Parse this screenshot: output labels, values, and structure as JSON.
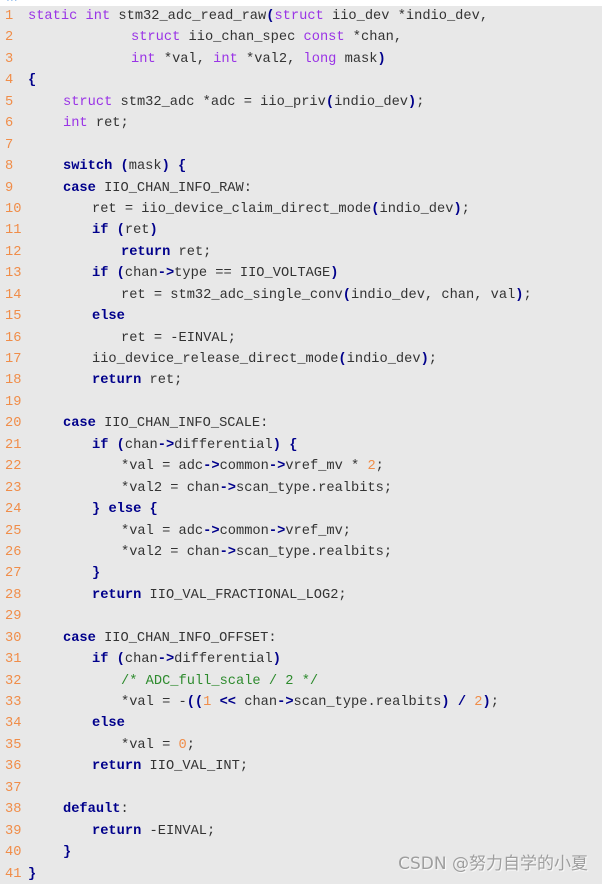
{
  "page": {
    "cutoff_text": "...",
    "watermark": "CSDN @努力自学的小夏",
    "colors": {
      "background": "#e8e8e8",
      "line_number": "#f08d49",
      "keyword": "#00008b",
      "type": "#9a34e6",
      "number": "#f08d49",
      "comment": "#2e8b2e",
      "text": "#333333"
    }
  },
  "code": {
    "language": "c",
    "lines": [
      {
        "n": "1",
        "indent": "i0",
        "tokens": [
          [
            "type",
            "static"
          ],
          [
            "text",
            " "
          ],
          [
            "type",
            "int"
          ],
          [
            "text",
            " stm32_adc_read_raw"
          ],
          [
            "op",
            "("
          ],
          [
            "type",
            "struct"
          ],
          [
            "text",
            " iio_dev *indio_dev,"
          ]
        ]
      },
      {
        "n": "2",
        "indent": "icont",
        "tokens": [
          [
            "type",
            "struct"
          ],
          [
            "text",
            " iio_chan_spec "
          ],
          [
            "type",
            "const"
          ],
          [
            "text",
            " *chan,"
          ]
        ]
      },
      {
        "n": "3",
        "indent": "icont",
        "tokens": [
          [
            "type",
            "int"
          ],
          [
            "text",
            " *val, "
          ],
          [
            "type",
            "int"
          ],
          [
            "text",
            " *val2, "
          ],
          [
            "type",
            "long"
          ],
          [
            "text",
            " mask"
          ],
          [
            "op",
            ")"
          ]
        ]
      },
      {
        "n": "4",
        "indent": "i0",
        "tokens": [
          [
            "op",
            "{"
          ]
        ]
      },
      {
        "n": "5",
        "indent": "i1",
        "tokens": [
          [
            "type",
            "struct"
          ],
          [
            "text",
            " stm32_adc *adc = iio_priv"
          ],
          [
            "op",
            "("
          ],
          [
            "text",
            "indio_dev"
          ],
          [
            "op",
            ")"
          ],
          [
            "text",
            ";"
          ]
        ]
      },
      {
        "n": "6",
        "indent": "i1",
        "tokens": [
          [
            "type",
            "int"
          ],
          [
            "text",
            " ret;"
          ]
        ]
      },
      {
        "n": "7",
        "indent": "i0",
        "tokens": []
      },
      {
        "n": "8",
        "indent": "i1",
        "tokens": [
          [
            "kw",
            "switch"
          ],
          [
            "text",
            " "
          ],
          [
            "op",
            "("
          ],
          [
            "text",
            "mask"
          ],
          [
            "op",
            ")"
          ],
          [
            "text",
            " "
          ],
          [
            "op",
            "{"
          ]
        ]
      },
      {
        "n": "9",
        "indent": "i1",
        "tokens": [
          [
            "kw",
            "case"
          ],
          [
            "text",
            " IIO_CHAN_INFO_RAW:"
          ]
        ]
      },
      {
        "n": "10",
        "indent": "i2",
        "tokens": [
          [
            "text",
            "ret = iio_device_claim_direct_mode"
          ],
          [
            "op",
            "("
          ],
          [
            "text",
            "indio_dev"
          ],
          [
            "op",
            ")"
          ],
          [
            "text",
            ";"
          ]
        ]
      },
      {
        "n": "11",
        "indent": "i2",
        "tokens": [
          [
            "kw",
            "if"
          ],
          [
            "text",
            " "
          ],
          [
            "op",
            "("
          ],
          [
            "text",
            "ret"
          ],
          [
            "op",
            ")"
          ]
        ]
      },
      {
        "n": "12",
        "indent": "i3",
        "tokens": [
          [
            "kw",
            "return"
          ],
          [
            "text",
            " ret;"
          ]
        ]
      },
      {
        "n": "13",
        "indent": "i2",
        "tokens": [
          [
            "kw",
            "if"
          ],
          [
            "text",
            " "
          ],
          [
            "op",
            "("
          ],
          [
            "text",
            "chan"
          ],
          [
            "op",
            "->"
          ],
          [
            "text",
            "type == IIO_VOLTAGE"
          ],
          [
            "op",
            ")"
          ]
        ]
      },
      {
        "n": "14",
        "indent": "i3",
        "tokens": [
          [
            "text",
            "ret = stm32_adc_single_conv"
          ],
          [
            "op",
            "("
          ],
          [
            "text",
            "indio_dev, chan, val"
          ],
          [
            "op",
            ")"
          ],
          [
            "text",
            ";"
          ]
        ]
      },
      {
        "n": "15",
        "indent": "i2",
        "tokens": [
          [
            "kw",
            "else"
          ]
        ]
      },
      {
        "n": "16",
        "indent": "i3",
        "tokens": [
          [
            "text",
            "ret = -EINVAL;"
          ]
        ]
      },
      {
        "n": "17",
        "indent": "i2",
        "tokens": [
          [
            "text",
            "iio_device_release_direct_mode"
          ],
          [
            "op",
            "("
          ],
          [
            "text",
            "indio_dev"
          ],
          [
            "op",
            ")"
          ],
          [
            "text",
            ";"
          ]
        ]
      },
      {
        "n": "18",
        "indent": "i2",
        "tokens": [
          [
            "kw",
            "return"
          ],
          [
            "text",
            " ret;"
          ]
        ]
      },
      {
        "n": "19",
        "indent": "i0",
        "tokens": []
      },
      {
        "n": "20",
        "indent": "i1",
        "tokens": [
          [
            "kw",
            "case"
          ],
          [
            "text",
            " IIO_CHAN_INFO_SCALE:"
          ]
        ]
      },
      {
        "n": "21",
        "indent": "i2",
        "tokens": [
          [
            "kw",
            "if"
          ],
          [
            "text",
            " "
          ],
          [
            "op",
            "("
          ],
          [
            "text",
            "chan"
          ],
          [
            "op",
            "->"
          ],
          [
            "text",
            "differential"
          ],
          [
            "op",
            ")"
          ],
          [
            "text",
            " "
          ],
          [
            "op",
            "{"
          ]
        ]
      },
      {
        "n": "22",
        "indent": "i3",
        "tokens": [
          [
            "text",
            "*val = adc"
          ],
          [
            "op",
            "->"
          ],
          [
            "text",
            "common"
          ],
          [
            "op",
            "->"
          ],
          [
            "text",
            "vref_mv * "
          ],
          [
            "num",
            "2"
          ],
          [
            "text",
            ";"
          ]
        ]
      },
      {
        "n": "23",
        "indent": "i3",
        "tokens": [
          [
            "text",
            "*val2 = chan"
          ],
          [
            "op",
            "->"
          ],
          [
            "text",
            "scan_type.realbits;"
          ]
        ]
      },
      {
        "n": "24",
        "indent": "i2",
        "tokens": [
          [
            "op",
            "}"
          ],
          [
            "text",
            " "
          ],
          [
            "kw",
            "else"
          ],
          [
            "text",
            " "
          ],
          [
            "op",
            "{"
          ]
        ]
      },
      {
        "n": "25",
        "indent": "i3",
        "tokens": [
          [
            "text",
            "*val = adc"
          ],
          [
            "op",
            "->"
          ],
          [
            "text",
            "common"
          ],
          [
            "op",
            "->"
          ],
          [
            "text",
            "vref_mv;"
          ]
        ]
      },
      {
        "n": "26",
        "indent": "i3",
        "tokens": [
          [
            "text",
            "*val2 = chan"
          ],
          [
            "op",
            "->"
          ],
          [
            "text",
            "scan_type.realbits;"
          ]
        ]
      },
      {
        "n": "27",
        "indent": "i2",
        "tokens": [
          [
            "op",
            "}"
          ]
        ]
      },
      {
        "n": "28",
        "indent": "i2",
        "tokens": [
          [
            "kw",
            "return"
          ],
          [
            "text",
            " IIO_VAL_FRACTIONAL_LOG2;"
          ]
        ]
      },
      {
        "n": "29",
        "indent": "i0",
        "tokens": []
      },
      {
        "n": "30",
        "indent": "i1",
        "tokens": [
          [
            "kw",
            "case"
          ],
          [
            "text",
            " IIO_CHAN_INFO_OFFSET:"
          ]
        ]
      },
      {
        "n": "31",
        "indent": "i2",
        "tokens": [
          [
            "kw",
            "if"
          ],
          [
            "text",
            " "
          ],
          [
            "op",
            "("
          ],
          [
            "text",
            "chan"
          ],
          [
            "op",
            "->"
          ],
          [
            "text",
            "differential"
          ],
          [
            "op",
            ")"
          ]
        ]
      },
      {
        "n": "32",
        "indent": "i3",
        "tokens": [
          [
            "cmt",
            "/* ADC_full_scale / 2 */"
          ]
        ]
      },
      {
        "n": "33",
        "indent": "i3",
        "tokens": [
          [
            "text",
            "*val = -"
          ],
          [
            "op",
            "(("
          ],
          [
            "num",
            "1"
          ],
          [
            "text",
            " "
          ],
          [
            "op",
            "<<"
          ],
          [
            "text",
            " chan"
          ],
          [
            "op",
            "->"
          ],
          [
            "text",
            "scan_type.realbits"
          ],
          [
            "op",
            ")"
          ],
          [
            "text",
            " "
          ],
          [
            "op",
            "/"
          ],
          [
            "text",
            " "
          ],
          [
            "num",
            "2"
          ],
          [
            "op",
            ")"
          ],
          [
            "text",
            ";"
          ]
        ]
      },
      {
        "n": "34",
        "indent": "i2",
        "tokens": [
          [
            "kw",
            "else"
          ]
        ]
      },
      {
        "n": "35",
        "indent": "i3",
        "tokens": [
          [
            "text",
            "*val = "
          ],
          [
            "num",
            "0"
          ],
          [
            "text",
            ";"
          ]
        ]
      },
      {
        "n": "36",
        "indent": "i2",
        "tokens": [
          [
            "kw",
            "return"
          ],
          [
            "text",
            " IIO_VAL_INT;"
          ]
        ]
      },
      {
        "n": "37",
        "indent": "i0",
        "tokens": []
      },
      {
        "n": "38",
        "indent": "i1",
        "tokens": [
          [
            "kw",
            "default"
          ],
          [
            "text",
            ":"
          ]
        ]
      },
      {
        "n": "39",
        "indent": "i2",
        "tokens": [
          [
            "kw",
            "return"
          ],
          [
            "text",
            " -EINVAL;"
          ]
        ]
      },
      {
        "n": "40",
        "indent": "i1",
        "tokens": [
          [
            "op",
            "}"
          ]
        ]
      },
      {
        "n": "41",
        "indent": "i0",
        "tokens": [
          [
            "op",
            "}"
          ]
        ]
      }
    ]
  }
}
